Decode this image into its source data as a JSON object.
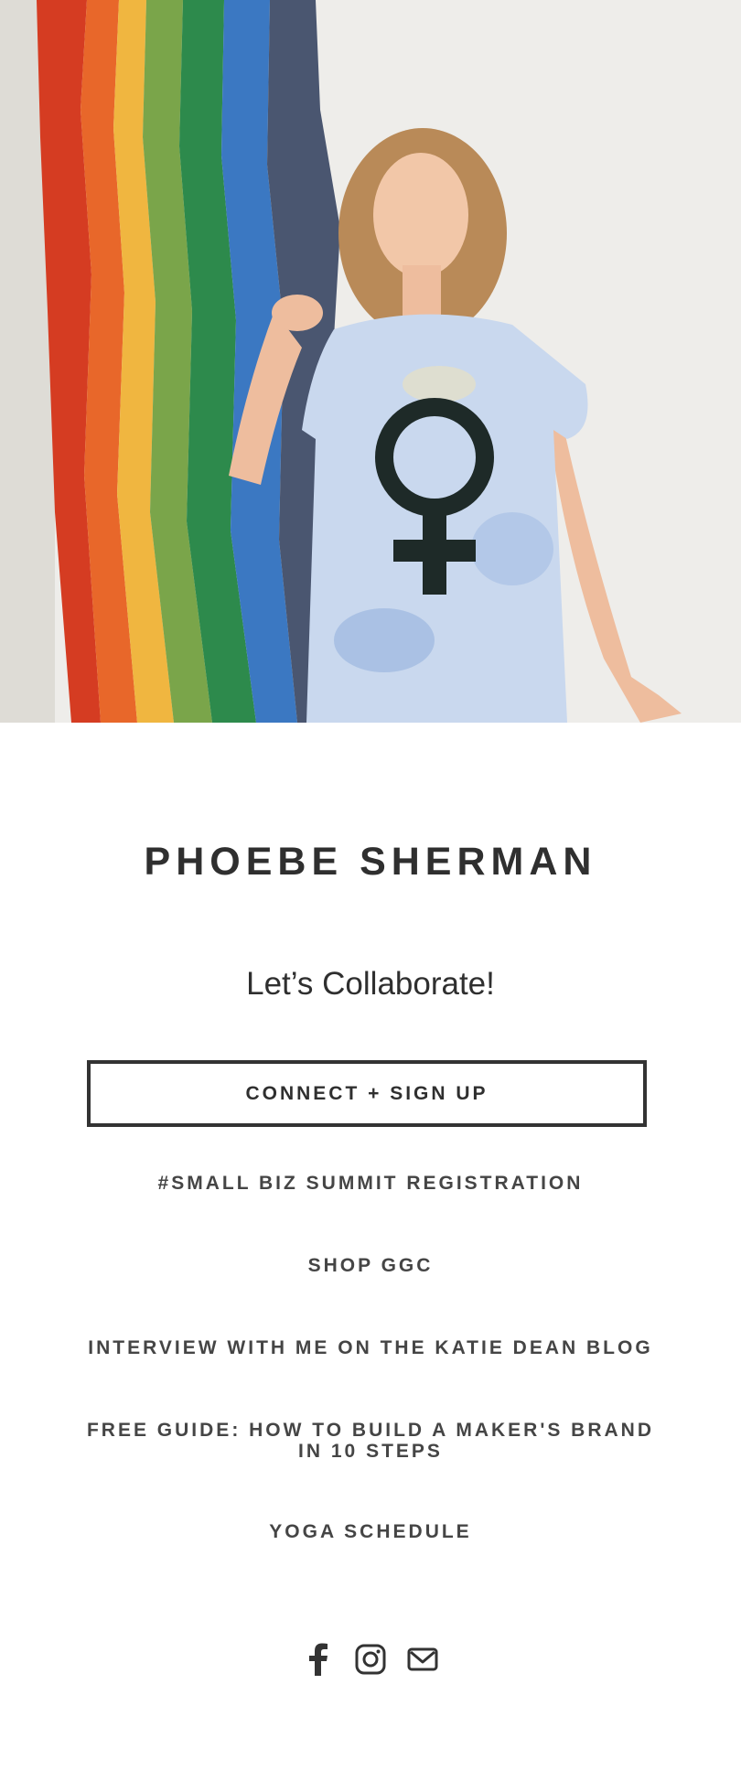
{
  "hero": {
    "image_icon": "hero-photo"
  },
  "profile": {
    "name": "PHOEBE SHERMAN",
    "tagline": "Let’s Collaborate!"
  },
  "links": {
    "connect": "CONNECT + SIGN UP",
    "summit": "#SMALL BIZ SUMMIT REGISTRATION",
    "shop": "SHOP GGC",
    "interview": "INTERVIEW WITH ME ON THE KATIE DEAN BLOG",
    "guide": "FREE GUIDE: HOW TO BUILD A MAKER'S BRAND IN 10 STEPS",
    "yoga": "YOGA SCHEDULE"
  },
  "social": {
    "icons": [
      "facebook-icon",
      "instagram-icon",
      "email-icon"
    ]
  },
  "colors": {
    "text": "#333333",
    "background": "#ffffff"
  }
}
